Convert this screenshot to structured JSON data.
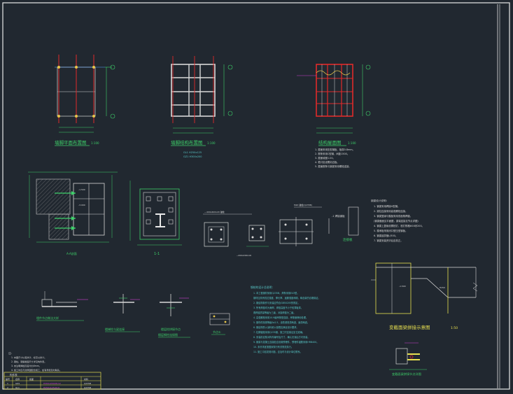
{
  "colors": {
    "background": "#212830",
    "border": "#e8e8e8",
    "axis": "#cfcfcf",
    "column": "#e02a2a",
    "node": "#e8c64a",
    "beam": "#d8d8d8",
    "dim": "#3ed06a",
    "note_text": "#58c8c8",
    "title_text": "#3ed06a",
    "accent": "#d040d0",
    "hatch": "#c8c8c8",
    "table": "#e8e050"
  },
  "plans": {
    "column_plan_title": "墙脚平面布置图",
    "beam_plan_title": "墙脚结构布置图",
    "roof_plan_title": "结构屋面图",
    "scale": "1:100"
  },
  "details": {
    "section_label": "A-A剖面",
    "section2_label": "1-1",
    "detail_a": "节点详图",
    "detail_b": "节点详图",
    "beam_column_title": "变截面梁拼接示意图",
    "beam_column_scale": "1:50",
    "base_detail": "埋件节点做法大样",
    "stair_detail": "楼梯柱与梁连接",
    "column_joint": "楼层柱拼接节点",
    "column_joint_sub": "楼层钢柱连接图",
    "connection": "连接板",
    "small_detail": "节点①",
    "bottom_right_detail": "变截面梁拼接节点详图"
  },
  "notes": {
    "header": "钢结构设计总说明：",
    "lines": [
      "1. 本工程钢材采用Q235B，焊条采用E43型。",
      "   钢材应具有抗拉强度、伸长率、屈服强度和硫、磷含量的合格保证。",
      "2. 钢结构制作与安装应符合GB50205的规定。",
      "3. 所有焊缝均为满焊，焊缝高度不小于较薄板厚。",
      "   角焊缝质量等级为三级，对接焊缝为二级。",
      "4. 高强螺栓采用10.9级摩擦型连接，摩擦面喷砂处理。",
      "5. 钢构件除锈等级Sa2.5，涂防锈底漆两道，面漆两道。",
      "6. 钢结构防火涂料耐火极限应满足设计要求。",
      "7. 柱脚锚栓采用Q235钢，施工时应保证定位准确。",
      "8. 安装前应核对构件编号及尺寸，确认无误后方可安装。",
      "9. 钢梁与混凝土连接处应设置预埋件，预埋件锚筋采用HRB400。",
      "10. 未尽事宜按国家现行有关规范执行。",
      "11. 施工中如发现问题，应及时与设计单位联系。"
    ],
    "top_right_header": "钢梁设计说明：",
    "top_right_lines": [
      "1. 钢梁采用焊接H型钢。",
      "2. 梁柱连接采用高强螺栓连接。",
      "3. 钢梁翼缘与腹板采用双面角焊缝。",
      "   (钢梁截面见平面图，梁端连接见节点详图)",
      "4. 钢梁上翼缘设置栓钉，栓钉规格Φ16@200。",
      "5. 楼承板采用闭口型压型钢板。",
      "6. 钢梁起拱值L/500。",
      "7. 钢梁安装完毕后应校正。"
    ],
    "roof_notes": [
      "1. 屋面采用压型钢板，板厚0.8mm。",
      "2. 檩条采用C型钢，间距1500。",
      "3. 屋面坡度1:20。",
      "4. 檐口处设置封边板。",
      "5. 屋面檩条与钢梁采用螺栓连接。"
    ],
    "bottom_left_header": "注：",
    "bottom_left_lines": [
      "1. 本图尺寸以毫米计，标高以米计。",
      "2. 钢柱、钢梁截面尺寸详见构件表。",
      "3. 未注明焊缝高度均为6mm。",
      "4. 施工时应与建筑图配合施工，如有矛盾及时联系。"
    ]
  },
  "table": {
    "title": "构件表",
    "headers": [
      "编号",
      "名称",
      "截面",
      "材料"
    ],
    "rows": [
      [
        "1",
        "GZ1",
        "H300x200x8x12",
        "Q235B"
      ],
      [
        "2",
        "GL1",
        "H250x125x6x9",
        "Q235B"
      ]
    ]
  }
}
